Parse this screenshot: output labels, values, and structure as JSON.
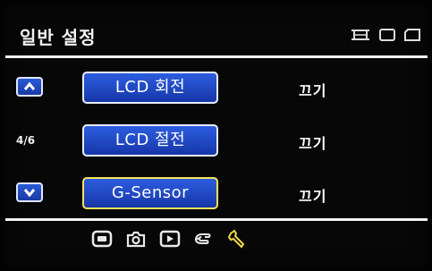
{
  "header": {
    "title": "일반 설정",
    "icons": [
      "film-strip-icon",
      "rectangle-icon",
      "card-icon"
    ]
  },
  "nav": {
    "up_label": "up-arrow",
    "down_label": "down-arrow",
    "page_indicator": "4/6"
  },
  "options": [
    {
      "label": "LCD 회전",
      "value": "끄기",
      "selected": false
    },
    {
      "label": "LCD 절전",
      "value": "끄기",
      "selected": false
    },
    {
      "label": "G-Sensor",
      "value": "끄기",
      "selected": true
    }
  ],
  "tabs": [
    {
      "name": "video-tab",
      "icon": "video-icon"
    },
    {
      "name": "camera-tab",
      "icon": "camera-icon"
    },
    {
      "name": "playback-tab",
      "icon": "playback-icon"
    },
    {
      "name": "setup-tab",
      "icon": "hand-icon"
    },
    {
      "name": "tools-tab",
      "icon": "wrench-icon",
      "active": true
    }
  ],
  "colors": {
    "button_blue": "#2346c8",
    "selected_border": "#f3e35a",
    "active_tab": "#f2d64a",
    "text": "#ffffff"
  }
}
